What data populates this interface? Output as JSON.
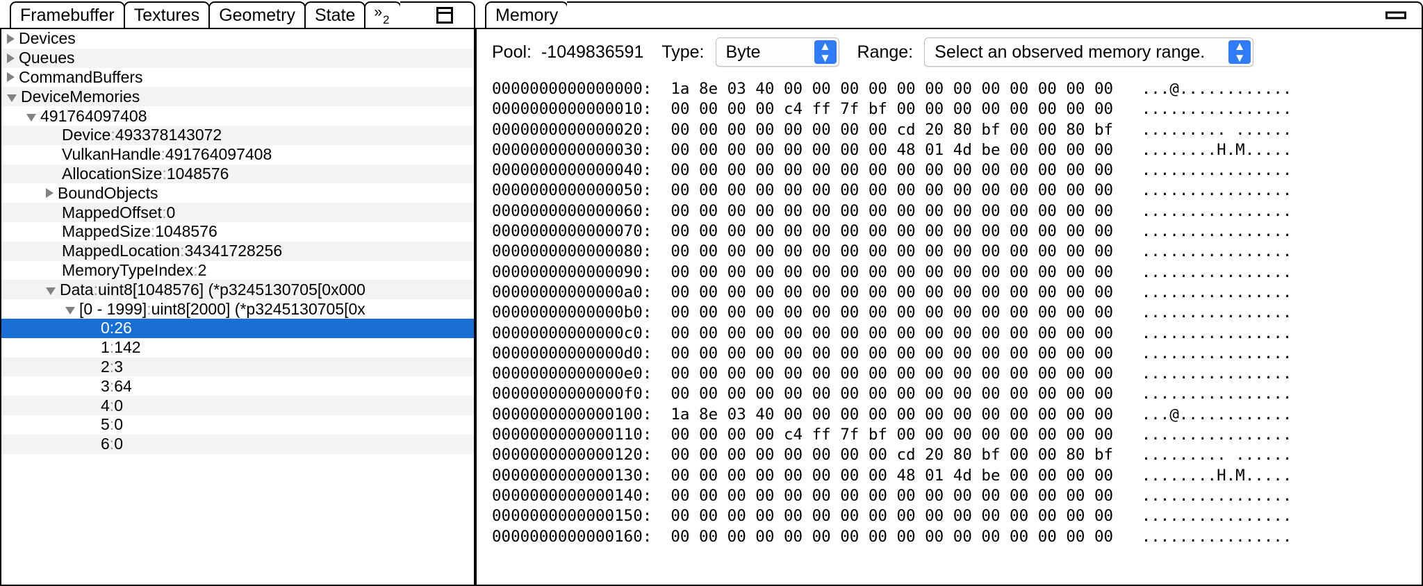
{
  "left_panel": {
    "tabs": [
      {
        "label": "Framebuffer"
      },
      {
        "label": "Textures"
      },
      {
        "label": "Geometry"
      },
      {
        "label": "State"
      }
    ],
    "overflow": {
      "chevron": "»",
      "count": "2"
    },
    "window_button": "restore-icon",
    "tree": [
      {
        "indent": 0,
        "twisty": "closed",
        "label": "Devices",
        "sep": "",
        "value": "",
        "selected": false
      },
      {
        "indent": 0,
        "twisty": "closed",
        "label": "Queues",
        "sep": "",
        "value": "",
        "selected": false
      },
      {
        "indent": 0,
        "twisty": "closed",
        "label": "CommandBuffers",
        "sep": "",
        "value": "",
        "selected": false
      },
      {
        "indent": 0,
        "twisty": "open",
        "label": "DeviceMemories",
        "sep": "",
        "value": "",
        "selected": false
      },
      {
        "indent": 1,
        "twisty": "open",
        "label": "491764097408",
        "sep": "",
        "value": "",
        "selected": false
      },
      {
        "indent": 2,
        "twisty": "none",
        "label": "Device",
        "sep": ":",
        "value": "493378143072",
        "selected": false
      },
      {
        "indent": 2,
        "twisty": "none",
        "label": "VulkanHandle",
        "sep": ":",
        "value": "491764097408",
        "selected": false
      },
      {
        "indent": 2,
        "twisty": "none",
        "label": "AllocationSize",
        "sep": ":",
        "value": "1048576",
        "selected": false
      },
      {
        "indent": 2,
        "twisty": "closed",
        "label": "BoundObjects",
        "sep": "",
        "value": "",
        "selected": false
      },
      {
        "indent": 2,
        "twisty": "none",
        "label": "MappedOffset",
        "sep": ":",
        "value": "0",
        "selected": false
      },
      {
        "indent": 2,
        "twisty": "none",
        "label": "MappedSize",
        "sep": ":",
        "value": "1048576",
        "selected": false
      },
      {
        "indent": 2,
        "twisty": "none",
        "label": "MappedLocation",
        "sep": ":",
        "value": "34341728256",
        "selected": false
      },
      {
        "indent": 2,
        "twisty": "none",
        "label": "MemoryTypeIndex",
        "sep": ":",
        "value": "2",
        "selected": false
      },
      {
        "indent": 2,
        "twisty": "open",
        "label": "Data",
        "sep": ":",
        "value": "uint8[1048576] (*p3245130705[0x000",
        "selected": false
      },
      {
        "indent": 3,
        "twisty": "open",
        "label": "[0 - 1999]",
        "sep": ":",
        "value": "uint8[2000] (*p3245130705[0x",
        "selected": false
      },
      {
        "indent": 4,
        "twisty": "none",
        "label": "0",
        "sep": ":",
        "value": "26",
        "selected": true
      },
      {
        "indent": 4,
        "twisty": "none",
        "label": "1",
        "sep": ":",
        "value": "142",
        "selected": false
      },
      {
        "indent": 4,
        "twisty": "none",
        "label": "2",
        "sep": ":",
        "value": "3",
        "selected": false
      },
      {
        "indent": 4,
        "twisty": "none",
        "label": "3",
        "sep": ":",
        "value": "64",
        "selected": false
      },
      {
        "indent": 4,
        "twisty": "none",
        "label": "4",
        "sep": ":",
        "value": "0",
        "selected": false
      },
      {
        "indent": 4,
        "twisty": "none",
        "label": "5",
        "sep": ":",
        "value": "0",
        "selected": false
      },
      {
        "indent": 4,
        "twisty": "none",
        "label": "6",
        "sep": ":",
        "value": "0",
        "selected": false
      }
    ]
  },
  "right_panel": {
    "tabs": [
      {
        "label": "Memory"
      }
    ],
    "window_button": "minimize-icon",
    "toolbar": {
      "pool_label": "Pool:",
      "pool_value": "-1049836591",
      "type_label": "Type:",
      "type_value": "Byte",
      "range_label": "Range:",
      "range_value": "Select an observed memory range."
    },
    "hex_rows": [
      {
        "offset": "0000000000000000",
        "bytes": "1a 8e 03 40 00 00 00 00 00 00 00 00 00 00 00 00",
        "ascii": "...@............"
      },
      {
        "offset": "0000000000000010",
        "bytes": "00 00 00 00 c4 ff 7f bf 00 00 00 00 00 00 00 00",
        "ascii": "................"
      },
      {
        "offset": "0000000000000020",
        "bytes": "00 00 00 00 00 00 00 00 cd 20 80 bf 00 00 80 bf",
        "ascii": "......... ......"
      },
      {
        "offset": "0000000000000030",
        "bytes": "00 00 00 00 00 00 00 00 48 01 4d be 00 00 00 00",
        "ascii": "........H.M....."
      },
      {
        "offset": "0000000000000040",
        "bytes": "00 00 00 00 00 00 00 00 00 00 00 00 00 00 00 00",
        "ascii": "................"
      },
      {
        "offset": "0000000000000050",
        "bytes": "00 00 00 00 00 00 00 00 00 00 00 00 00 00 00 00",
        "ascii": "................"
      },
      {
        "offset": "0000000000000060",
        "bytes": "00 00 00 00 00 00 00 00 00 00 00 00 00 00 00 00",
        "ascii": "................"
      },
      {
        "offset": "0000000000000070",
        "bytes": "00 00 00 00 00 00 00 00 00 00 00 00 00 00 00 00",
        "ascii": "................"
      },
      {
        "offset": "0000000000000080",
        "bytes": "00 00 00 00 00 00 00 00 00 00 00 00 00 00 00 00",
        "ascii": "................"
      },
      {
        "offset": "0000000000000090",
        "bytes": "00 00 00 00 00 00 00 00 00 00 00 00 00 00 00 00",
        "ascii": "................"
      },
      {
        "offset": "00000000000000a0",
        "bytes": "00 00 00 00 00 00 00 00 00 00 00 00 00 00 00 00",
        "ascii": "................"
      },
      {
        "offset": "00000000000000b0",
        "bytes": "00 00 00 00 00 00 00 00 00 00 00 00 00 00 00 00",
        "ascii": "................"
      },
      {
        "offset": "00000000000000c0",
        "bytes": "00 00 00 00 00 00 00 00 00 00 00 00 00 00 00 00",
        "ascii": "................"
      },
      {
        "offset": "00000000000000d0",
        "bytes": "00 00 00 00 00 00 00 00 00 00 00 00 00 00 00 00",
        "ascii": "................"
      },
      {
        "offset": "00000000000000e0",
        "bytes": "00 00 00 00 00 00 00 00 00 00 00 00 00 00 00 00",
        "ascii": "................"
      },
      {
        "offset": "00000000000000f0",
        "bytes": "00 00 00 00 00 00 00 00 00 00 00 00 00 00 00 00",
        "ascii": "................"
      },
      {
        "offset": "0000000000000100",
        "bytes": "1a 8e 03 40 00 00 00 00 00 00 00 00 00 00 00 00",
        "ascii": "...@............"
      },
      {
        "offset": "0000000000000110",
        "bytes": "00 00 00 00 c4 ff 7f bf 00 00 00 00 00 00 00 00",
        "ascii": "................"
      },
      {
        "offset": "0000000000000120",
        "bytes": "00 00 00 00 00 00 00 00 cd 20 80 bf 00 00 80 bf",
        "ascii": "......... ......"
      },
      {
        "offset": "0000000000000130",
        "bytes": "00 00 00 00 00 00 00 00 48 01 4d be 00 00 00 00",
        "ascii": "........H.M....."
      },
      {
        "offset": "0000000000000140",
        "bytes": "00 00 00 00 00 00 00 00 00 00 00 00 00 00 00 00",
        "ascii": "................"
      },
      {
        "offset": "0000000000000150",
        "bytes": "00 00 00 00 00 00 00 00 00 00 00 00 00 00 00 00",
        "ascii": "................"
      },
      {
        "offset": "0000000000000160",
        "bytes": "00 00 00 00 00 00 00 00 00 00 00 00 00 00 00 00",
        "ascii": "................"
      }
    ]
  },
  "colors": {
    "selection_blue": "#1a6fd4",
    "stepper_blue": "#2f7cf6",
    "alt_row": "#f2f3f4",
    "dim_text": "#9a9a9a"
  }
}
